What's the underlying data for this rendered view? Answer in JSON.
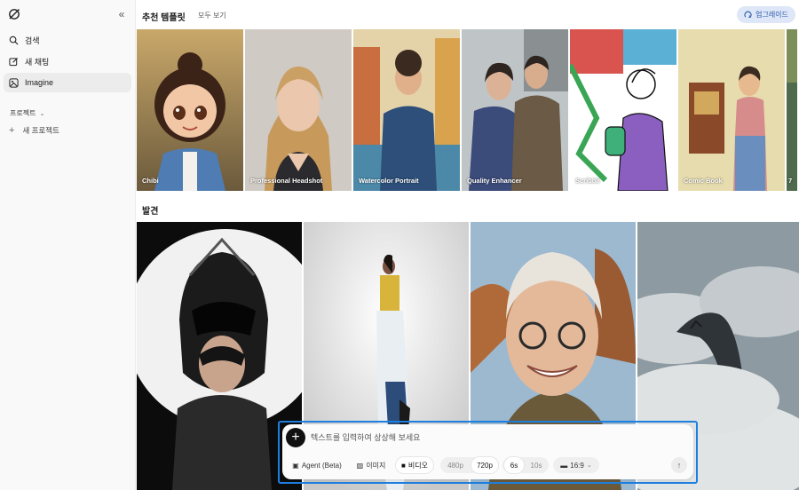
{
  "sidebar": {
    "items": [
      {
        "label": "검색",
        "icon": "search-icon"
      },
      {
        "label": "새 채팅",
        "icon": "edit-icon"
      },
      {
        "label": "Imagine",
        "icon": "imagine-icon",
        "active": true
      }
    ],
    "section_label": "프로젝트",
    "new_project": "새 프로젝트"
  },
  "header": {
    "title": "추천 템플릿",
    "see_all": "모두 보기",
    "upgrade": "업그레이드"
  },
  "templates": [
    {
      "label": "Chibi"
    },
    {
      "label": "Professional Headshot"
    },
    {
      "label": "Watercolor Portrait"
    },
    {
      "label": "Quality Enhancer"
    },
    {
      "label": "Scribbli"
    },
    {
      "label": "Comic Book"
    },
    {
      "label": "7"
    }
  ],
  "discover": {
    "title": "발견",
    "cards": [
      {
        "subject": "helmet-figure"
      },
      {
        "subject": "fashion-model"
      },
      {
        "subject": "smiling-elder"
      },
      {
        "subject": "dinosaur-in-clouds"
      }
    ]
  },
  "composer": {
    "placeholder": "텍스트를 입력하여 상상해 보세요",
    "value": "",
    "agent_label": "Agent (Beta)",
    "mode_image": "이미지",
    "mode_video": "비디오",
    "res_480": "480p",
    "res_720": "720p",
    "dur_6": "6s",
    "dur_10": "10s",
    "aspect": "16:9"
  },
  "colors": {
    "accent": "#1e7fe0",
    "upgrade_bg": "#dde7f7",
    "upgrade_text": "#2a55a8"
  }
}
